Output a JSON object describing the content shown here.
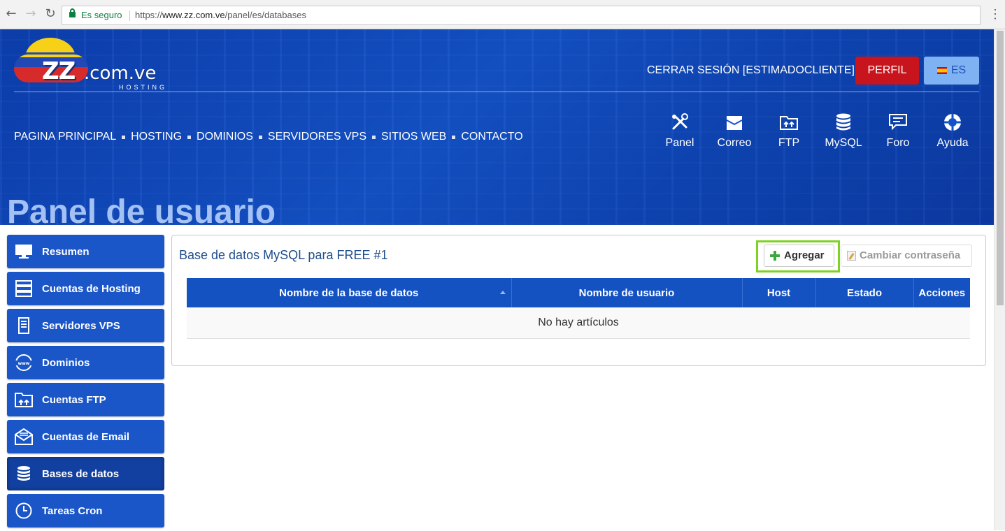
{
  "browser": {
    "secure_label": "Es seguro",
    "url_scheme": "https://",
    "url_host": "www.zz.com.ve",
    "url_path": "/panel/es/databases",
    "icons": [
      "back-arrow-icon",
      "forward-arrow-icon",
      "reload-icon",
      "lock-icon",
      "menu-dots-icon"
    ]
  },
  "header": {
    "logo_main": "ZZ",
    "logo_tld": ".com.ve",
    "logo_sub": "HOSTING",
    "logout_label": "CERRAR SESIÓN [ESTIMADOCLIENTE]",
    "profile_button": "PERFIL",
    "language_button": "ES",
    "page_title": "Panel de usuario",
    "nav": [
      {
        "label": "PAGINA PRINCIPAL"
      },
      {
        "label": "HOSTING"
      },
      {
        "label": "DOMINIOS"
      },
      {
        "label": "SERVIDORES VPS"
      },
      {
        "label": "SITIOS WEB"
      },
      {
        "label": "CONTACTO"
      }
    ],
    "quick_links": [
      {
        "label": "Panel",
        "icon": "tools-icon"
      },
      {
        "label": "Correo",
        "icon": "envelope-icon"
      },
      {
        "label": "FTP",
        "icon": "folder-upload-icon"
      },
      {
        "label": "MySQL",
        "icon": "database-icon"
      },
      {
        "label": "Foro",
        "icon": "chat-icon"
      },
      {
        "label": "Ayuda",
        "icon": "lifebuoy-icon"
      }
    ]
  },
  "sidebar": {
    "items": [
      {
        "label": "Resumen",
        "icon": "monitor-icon",
        "active": false
      },
      {
        "label": "Cuentas de Hosting",
        "icon": "server-rack-icon",
        "active": false
      },
      {
        "label": "Servidores VPS",
        "icon": "server-tower-icon",
        "active": false
      },
      {
        "label": "Dominios",
        "icon": "globe-www-icon",
        "active": false
      },
      {
        "label": "Cuentas FTP",
        "icon": "folder-upload-icon",
        "active": false
      },
      {
        "label": "Cuentas de Email",
        "icon": "envelope-open-icon",
        "active": false
      },
      {
        "label": "Bases de datos",
        "icon": "database-icon",
        "active": true
      },
      {
        "label": "Tareas Cron",
        "icon": "clock-icon",
        "active": false
      }
    ]
  },
  "main": {
    "panel_title": "Base de datos MySQL para FREE #1",
    "add_button": "Agregar",
    "change_password_button": "Cambiar contraseña",
    "table": {
      "columns": [
        "Nombre de la base de datos",
        "Nombre de usuario",
        "Host",
        "Estado",
        "Acciones"
      ],
      "empty_message": "No hay artículos"
    }
  },
  "colors": {
    "header_blue": "#1452c7",
    "sidebar_blue": "#1a56c7",
    "table_header_blue": "#1552c1",
    "perfil_red": "#c8141c",
    "lang_light_blue": "#7fb2f2",
    "highlight_green": "#7ed321"
  }
}
